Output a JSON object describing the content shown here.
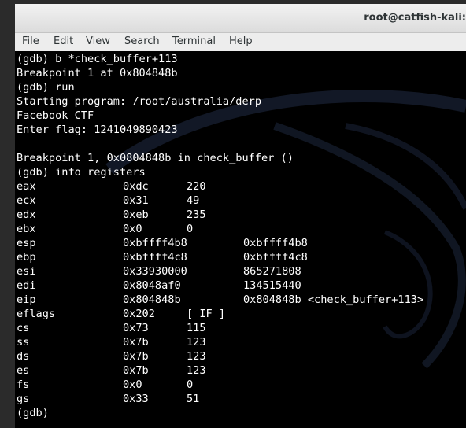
{
  "window": {
    "title": "root@catfish-kali:"
  },
  "menubar": {
    "items": [
      {
        "label": "File"
      },
      {
        "label": "Edit"
      },
      {
        "label": "View"
      },
      {
        "label": "Search"
      },
      {
        "label": "Terminal"
      },
      {
        "label": "Help"
      }
    ]
  },
  "terminal": {
    "lines_before": [
      "(gdb) b *check_buffer+113",
      "Breakpoint 1 at 0x804848b",
      "(gdb) run",
      "Starting program: /root/australia/derp",
      "Facebook CTF",
      "Enter flag: 1241049890423",
      "",
      "Breakpoint 1, 0x0804848b in check_buffer ()",
      "(gdb) info registers"
    ],
    "registers": [
      {
        "name": "eax",
        "hex": "0xdc",
        "dec": "220",
        "extra": ""
      },
      {
        "name": "ecx",
        "hex": "0x31",
        "dec": "49",
        "extra": ""
      },
      {
        "name": "edx",
        "hex": "0xeb",
        "dec": "235",
        "extra": ""
      },
      {
        "name": "ebx",
        "hex": "0x0",
        "dec": "0",
        "extra": ""
      },
      {
        "name": "esp",
        "hex": "0xbffff4b8",
        "dec": "",
        "extra": "0xbffff4b8"
      },
      {
        "name": "ebp",
        "hex": "0xbffff4c8",
        "dec": "",
        "extra": "0xbffff4c8"
      },
      {
        "name": "esi",
        "hex": "0x33930000",
        "dec": "",
        "extra": "865271808"
      },
      {
        "name": "edi",
        "hex": "0x8048af0",
        "dec": "",
        "extra": "134515440"
      },
      {
        "name": "eip",
        "hex": "0x804848b",
        "dec": "",
        "extra": "0x804848b <check_buffer+113>"
      },
      {
        "name": "eflags",
        "hex": "0x202",
        "dec": "[ IF ]",
        "extra": ""
      },
      {
        "name": "cs",
        "hex": "0x73",
        "dec": "115",
        "extra": ""
      },
      {
        "name": "ss",
        "hex": "0x7b",
        "dec": "123",
        "extra": ""
      },
      {
        "name": "ds",
        "hex": "0x7b",
        "dec": "123",
        "extra": ""
      },
      {
        "name": "es",
        "hex": "0x7b",
        "dec": "123",
        "extra": ""
      },
      {
        "name": "fs",
        "hex": "0x0",
        "dec": "0",
        "extra": ""
      },
      {
        "name": "gs",
        "hex": "0x33",
        "dec": "51",
        "extra": ""
      }
    ],
    "prompt": "(gdb)"
  }
}
